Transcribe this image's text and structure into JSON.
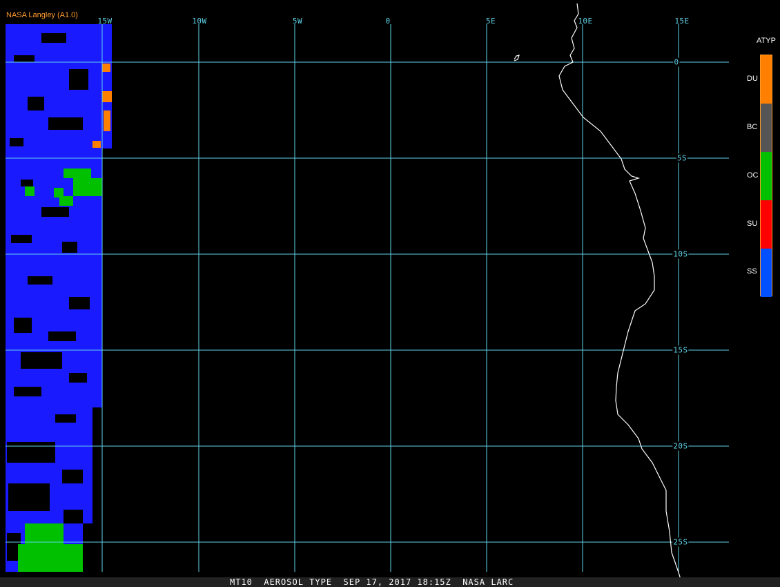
{
  "credit": "NASA Langley (A1.0)",
  "footer": "MT10  AEROSOL TYPE  SEP 17, 2017 18:15Z  NASA LARC",
  "legend": {
    "title": "ATYP",
    "items": [
      {
        "label": "DU",
        "color": "#ff8000"
      },
      {
        "label": "BC",
        "color": "#555555"
      },
      {
        "label": "OC",
        "color": "#00c000"
      },
      {
        "label": "SU",
        "color": "#ff0000"
      },
      {
        "label": "SS",
        "color": "#0050ff"
      }
    ]
  },
  "lon_labels": [
    "15W",
    "10W",
    "5W",
    "0",
    "5E",
    "10E",
    "15E"
  ],
  "lat_labels": [
    "0",
    "5S",
    "10S",
    "15S",
    "20S",
    "25S"
  ],
  "colors": {
    "grid": "#5fd3e8",
    "coast": "#ffffff",
    "aerosol_ss": "#1a1aff",
    "aerosol_oc": "#00c000",
    "aerosol_du": "#ff8000"
  }
}
